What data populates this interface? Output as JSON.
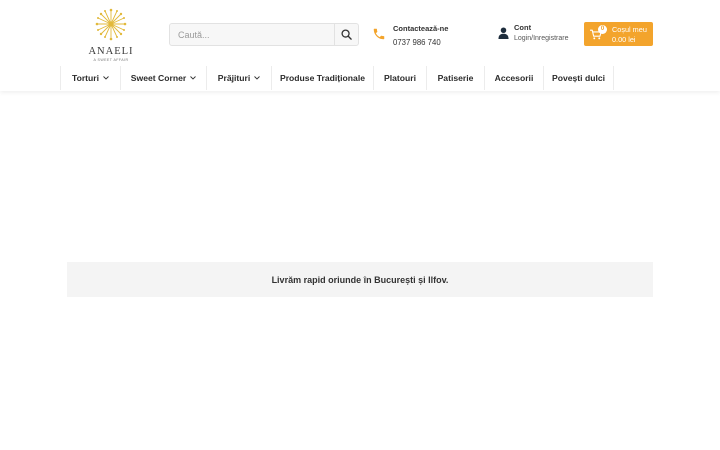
{
  "logo": {
    "brand": "ANAELI",
    "tagline": "A SWEET AFFAIR",
    "accent": "#e2b93b"
  },
  "search": {
    "placeholder": "Caută...",
    "value": "",
    "icon": "search-icon"
  },
  "contact": {
    "title": "Contactează-ne",
    "phone": "0737 986 740",
    "icon": "phone-icon",
    "icon_color": "#f3a42c"
  },
  "account": {
    "title": "Cont",
    "subtitle": "Login/Inregistrare",
    "icon": "user-icon"
  },
  "cart": {
    "count": "0",
    "label": "Coșul meu",
    "total": "0.00 lei",
    "icon": "cart-icon",
    "color": "#f3a42c"
  },
  "nav": {
    "items": [
      {
        "label": "Torturi",
        "has_dropdown": true
      },
      {
        "label": "Sweet Corner",
        "has_dropdown": true
      },
      {
        "label": "Prăjituri",
        "has_dropdown": true
      },
      {
        "label": "Produse Tradiționale",
        "has_dropdown": false
      },
      {
        "label": "Platouri",
        "has_dropdown": false
      },
      {
        "label": "Patiserie",
        "has_dropdown": false
      },
      {
        "label": "Accesorii",
        "has_dropdown": false
      },
      {
        "label": "Povești dulci",
        "has_dropdown": false
      }
    ]
  },
  "banner": {
    "text": "Livrăm rapid oriunde în București și Ilfov."
  }
}
